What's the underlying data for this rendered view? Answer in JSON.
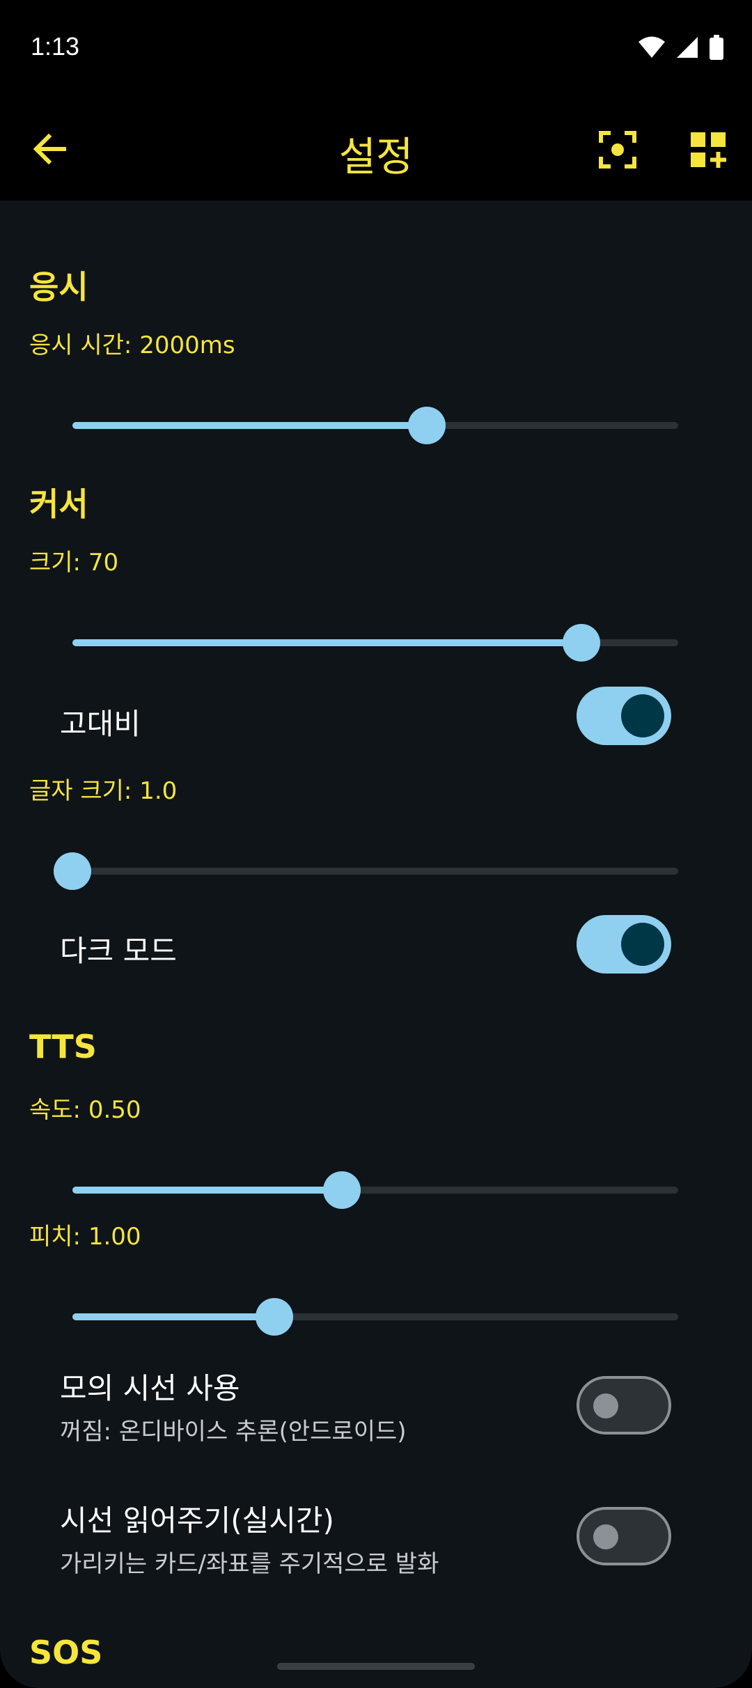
{
  "status": {
    "time": "1:13",
    "icons": [
      "wifi-icon",
      "signal-icon",
      "battery-icon"
    ]
  },
  "appbar": {
    "title": "설정",
    "icons": [
      "back-arrow-icon",
      "focus-center-icon",
      "add-widget-icon"
    ]
  },
  "colors": {
    "accent": "#f6e53d",
    "slider": "#8fd0f0",
    "background": "#0f1418",
    "switch_knob_on": "#003747"
  },
  "gaze": {
    "title": "응시",
    "dwell": {
      "label": "응시 시간: 2000ms",
      "value": 0.585
    }
  },
  "cursor": {
    "title": "커서",
    "size": {
      "label": "크기: 70",
      "value": 0.84
    },
    "high_contrast": {
      "label": "고대비",
      "on": true
    },
    "font_size": {
      "label": "글자 크기: 1.0",
      "value": 0.0
    },
    "dark_mode": {
      "label": "다크 모드",
      "on": true
    }
  },
  "tts": {
    "title": "TTS",
    "speed": {
      "label": "속도: 0.50",
      "value": 0.445
    },
    "pitch": {
      "label": "피치: 1.00",
      "value": 0.333
    },
    "mock_gaze": {
      "label": "모의 시선 사용",
      "sub": "꺼짐: 온디바이스 추론(안드로이드)",
      "on": false
    },
    "read_gaze": {
      "label": "시선 읽어주기(실시간)",
      "sub": "가리키는 카드/좌표를 주기적으로 발화",
      "on": false
    }
  },
  "sos": {
    "title": "SOS"
  }
}
